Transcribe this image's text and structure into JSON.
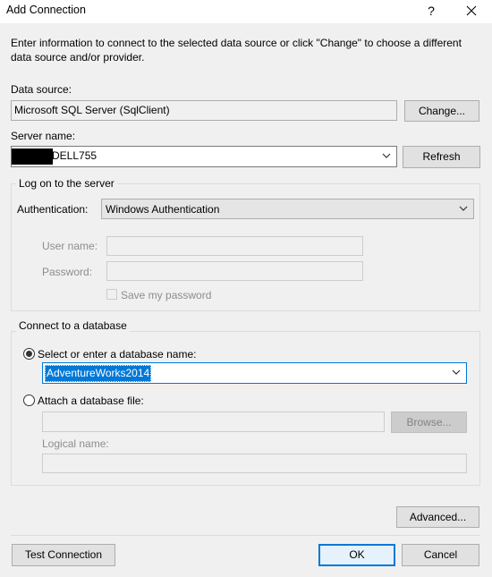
{
  "window": {
    "title": "Add Connection",
    "help_label": "?"
  },
  "intro_text": "Enter information to connect to the selected data source or click \"Change\" to choose a different data source and/or provider.",
  "data_source": {
    "label": "Data source:",
    "value": "Microsoft SQL Server (SqlClient)",
    "change_button": "Change..."
  },
  "server": {
    "label": "Server name:",
    "value": "DELL755",
    "refresh_button": "Refresh"
  },
  "logon": {
    "group_label": "Log on to the server",
    "auth_label": "Authentication:",
    "auth_value": "Windows Authentication",
    "user_label": "User name:",
    "password_label": "Password:",
    "save_password_label": "Save my password"
  },
  "database": {
    "group_label": "Connect to a database",
    "select_radio_label": "Select or enter a database name:",
    "db_value": "AdventureWorks2014",
    "attach_radio_label": "Attach a database file:",
    "browse_button": "Browse...",
    "logical_name_label": "Logical name:"
  },
  "buttons": {
    "advanced": "Advanced...",
    "test_connection": "Test Connection",
    "ok": "OK",
    "cancel": "Cancel"
  },
  "colors": {
    "ok_border": "#0078d7",
    "selection": "#0078d7"
  }
}
